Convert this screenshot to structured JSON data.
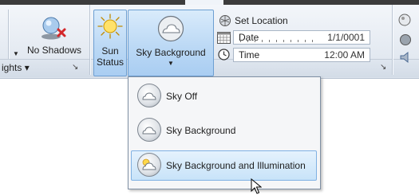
{
  "ribbon": {
    "no_shadows": {
      "label": "No Shadows",
      "icon": "shadow-off-icon"
    },
    "sun_status": {
      "line1": "Sun",
      "line2": "Status",
      "icon": "sun-icon"
    },
    "sky_background": {
      "label": "Sky Background",
      "icon": "sky-icon"
    },
    "set_location": {
      "label": "Set Location",
      "icon": "globe-location-icon"
    },
    "date": {
      "label": "Date",
      "value": "1/1/0001"
    },
    "time": {
      "label": "Time",
      "value": "12:00 AM"
    },
    "panel_lights": {
      "label": "ights",
      "dropdown_glyph": "▾",
      "launcher_glyph": "↘"
    },
    "panel_sun_launcher": "↘"
  },
  "menu": {
    "items": [
      {
        "label": "Sky Off",
        "icon": "sky-off-icon",
        "active": false
      },
      {
        "label": "Sky Background",
        "icon": "sky-background-icon",
        "active": false
      },
      {
        "label": "Sky Background and Illumination",
        "icon": "sky-illumination-icon",
        "active": true
      }
    ]
  },
  "colors": {
    "ribbon_bg": "#e3e9f1",
    "highlight_border": "#6d9fd2",
    "hover_bg": "#c8e3f9",
    "menu_bg": "#f5f6f8"
  }
}
